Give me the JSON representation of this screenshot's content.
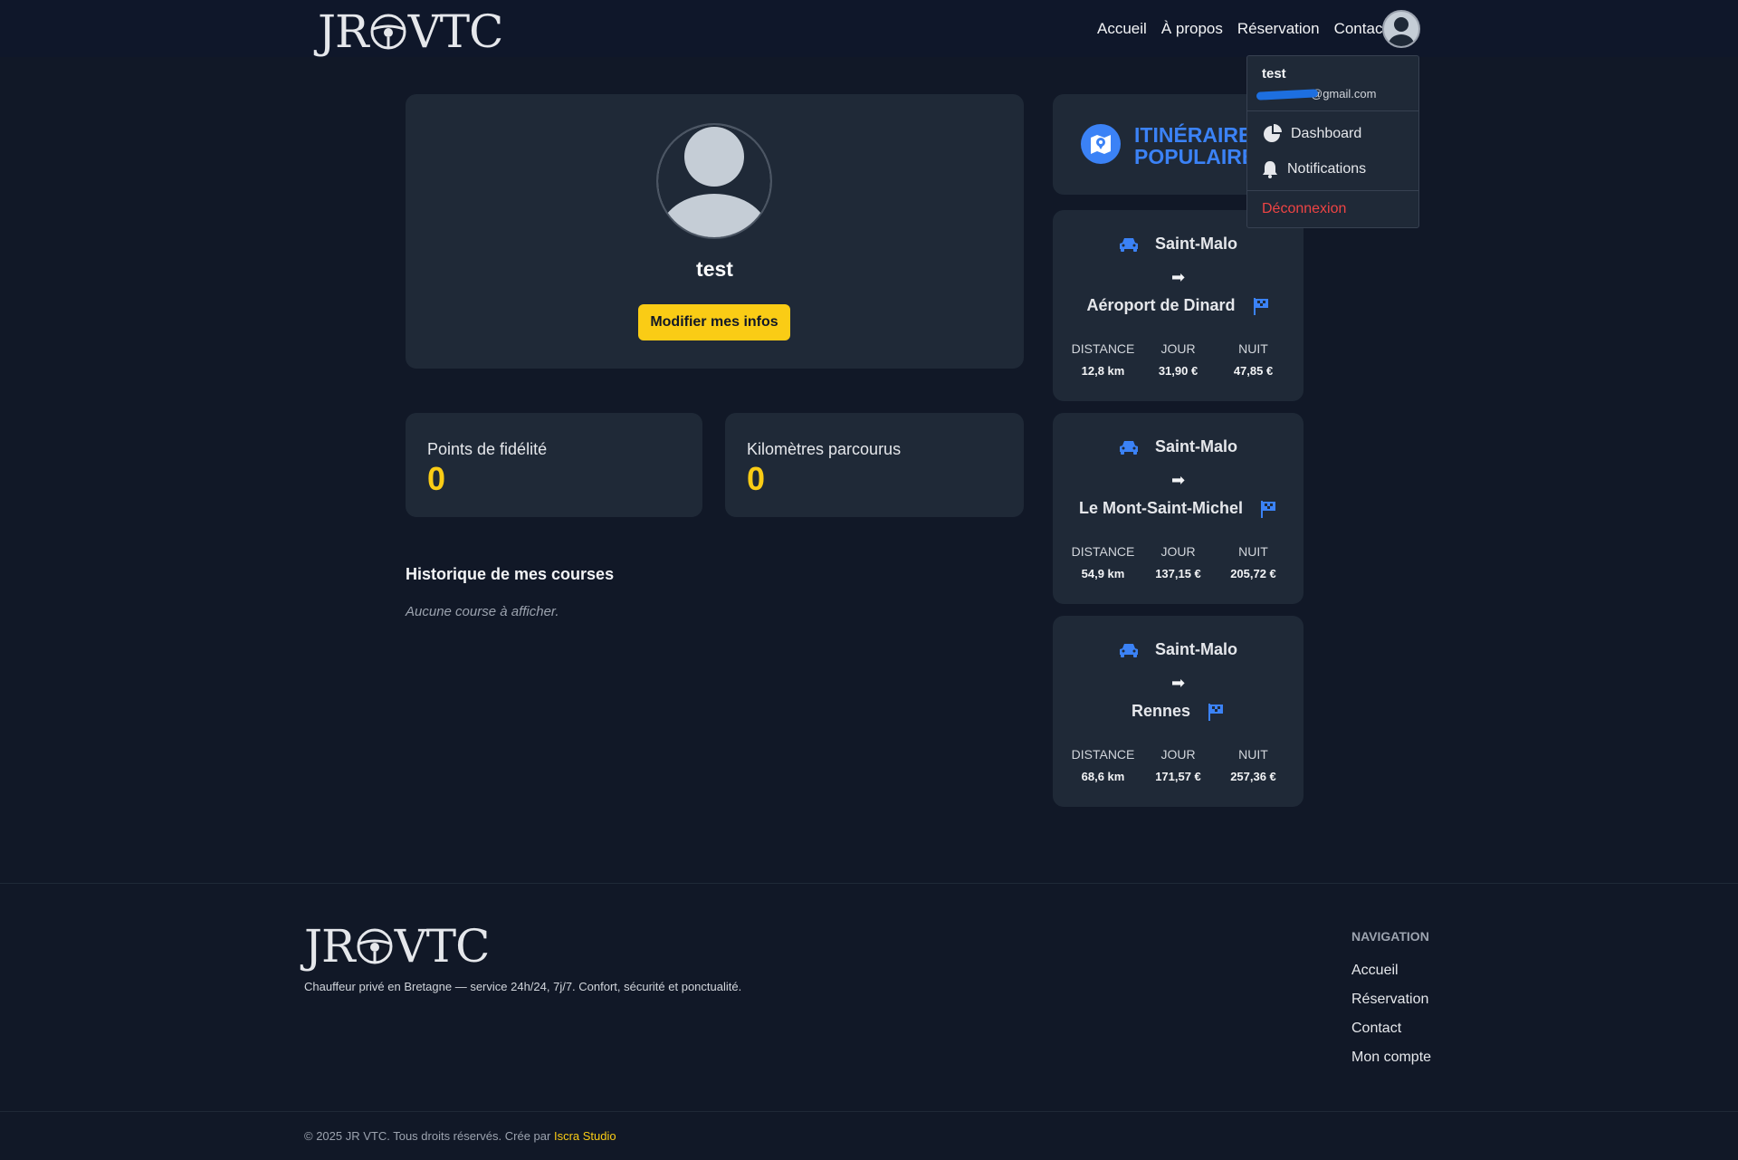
{
  "header": {
    "logo": {
      "left": "JR",
      "right": "VTC"
    },
    "nav": [
      "Accueil",
      "À propos",
      "Réservation",
      "Contact"
    ]
  },
  "dropdown": {
    "username": "test",
    "email_domain": "@gmail.com",
    "items": [
      "Dashboard",
      "Notifications"
    ],
    "logout": "Déconnexion"
  },
  "profile": {
    "name": "test",
    "edit_button": "Modifier mes infos"
  },
  "stats": [
    {
      "label": "Points de fidélité",
      "value": "0"
    },
    {
      "label": "Kilomètres parcourus",
      "value": "0"
    }
  ],
  "history": {
    "title": "Historique de mes courses",
    "empty": "Aucune course à afficher."
  },
  "itineraries": {
    "title_line1": "ITINÉRAIRES",
    "title_line2": "POPULAIRES",
    "arrow": "➡",
    "headers": {
      "distance": "DISTANCE",
      "day": "JOUR",
      "night": "NUIT"
    },
    "routes": [
      {
        "from": "Saint-Malo",
        "to": "Aéroport de Dinard",
        "distance": "12,8 km",
        "day": "31,90 €",
        "night": "47,85 €"
      },
      {
        "from": "Saint-Malo",
        "to": "Le Mont-Saint-Michel",
        "distance": "54,9 km",
        "day": "137,15 €",
        "night": "205,72 €"
      },
      {
        "from": "Saint-Malo",
        "to": "Rennes",
        "distance": "68,6 km",
        "day": "171,57 €",
        "night": "257,36 €"
      }
    ]
  },
  "footer": {
    "tagline": "Chauffeur privé en Bretagne — service 24h/24, 7j/7. Confort, sécurité et ponctualité.",
    "nav_title": "NAVIGATION",
    "nav": [
      "Accueil",
      "Réservation",
      "Contact",
      "Mon compte"
    ],
    "copyright": "© 2025 JR VTC. Tous droits réservés. Crée par",
    "studio": "Iscra Studio"
  },
  "colors": {
    "background": "#111827",
    "card": "#1f2937",
    "accent_yellow": "#facc15",
    "accent_blue": "#3b82f6",
    "danger": "#ef4444"
  }
}
